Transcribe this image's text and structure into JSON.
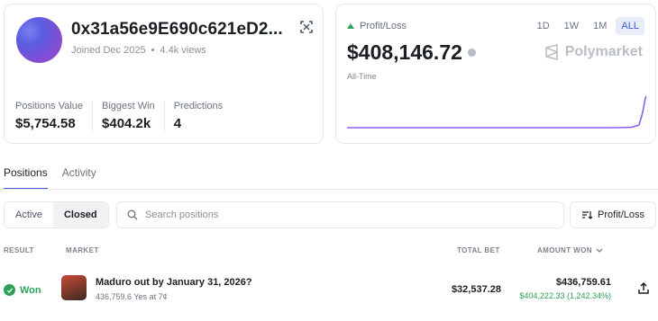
{
  "profile": {
    "name": "0x31a56e9E690c621eD2...",
    "joined": "Joined Dec 2025",
    "views": "4.4k views",
    "stats": [
      {
        "label": "Positions Value",
        "value": "$5,754.58"
      },
      {
        "label": "Biggest Win",
        "value": "$404.2k"
      },
      {
        "label": "Predictions",
        "value": "4"
      }
    ]
  },
  "pnl": {
    "label": "Profit/Loss",
    "value": "$408,146.72",
    "period": "All-Time",
    "brand": "Polymarket",
    "ranges": [
      "1D",
      "1W",
      "1M",
      "ALL"
    ],
    "active_range": "ALL",
    "line_color": "#8b5cf6"
  },
  "tabs": {
    "positions": "Positions",
    "activity": "Activity"
  },
  "filters": {
    "active": "Active",
    "closed": "Closed",
    "search_placeholder": "Search positions",
    "sort_label": "Profit/Loss"
  },
  "table": {
    "headers": {
      "result": "RESULT",
      "market": "MARKET",
      "total_bet": "TOTAL BET",
      "amount_won": "AMOUNT WON"
    },
    "rows": [
      {
        "result": "Won",
        "title": "Maduro out by January 31, 2026?",
        "subtitle": "436,759.6 Yes at 7¢",
        "total_bet": "$32,537.28",
        "amount_won": "$436,759.61",
        "gain": "$404,222.33 (1,242.34%)"
      }
    ]
  },
  "colors": {
    "accent": "#3b5bdb",
    "positive": "#2ea05a"
  }
}
